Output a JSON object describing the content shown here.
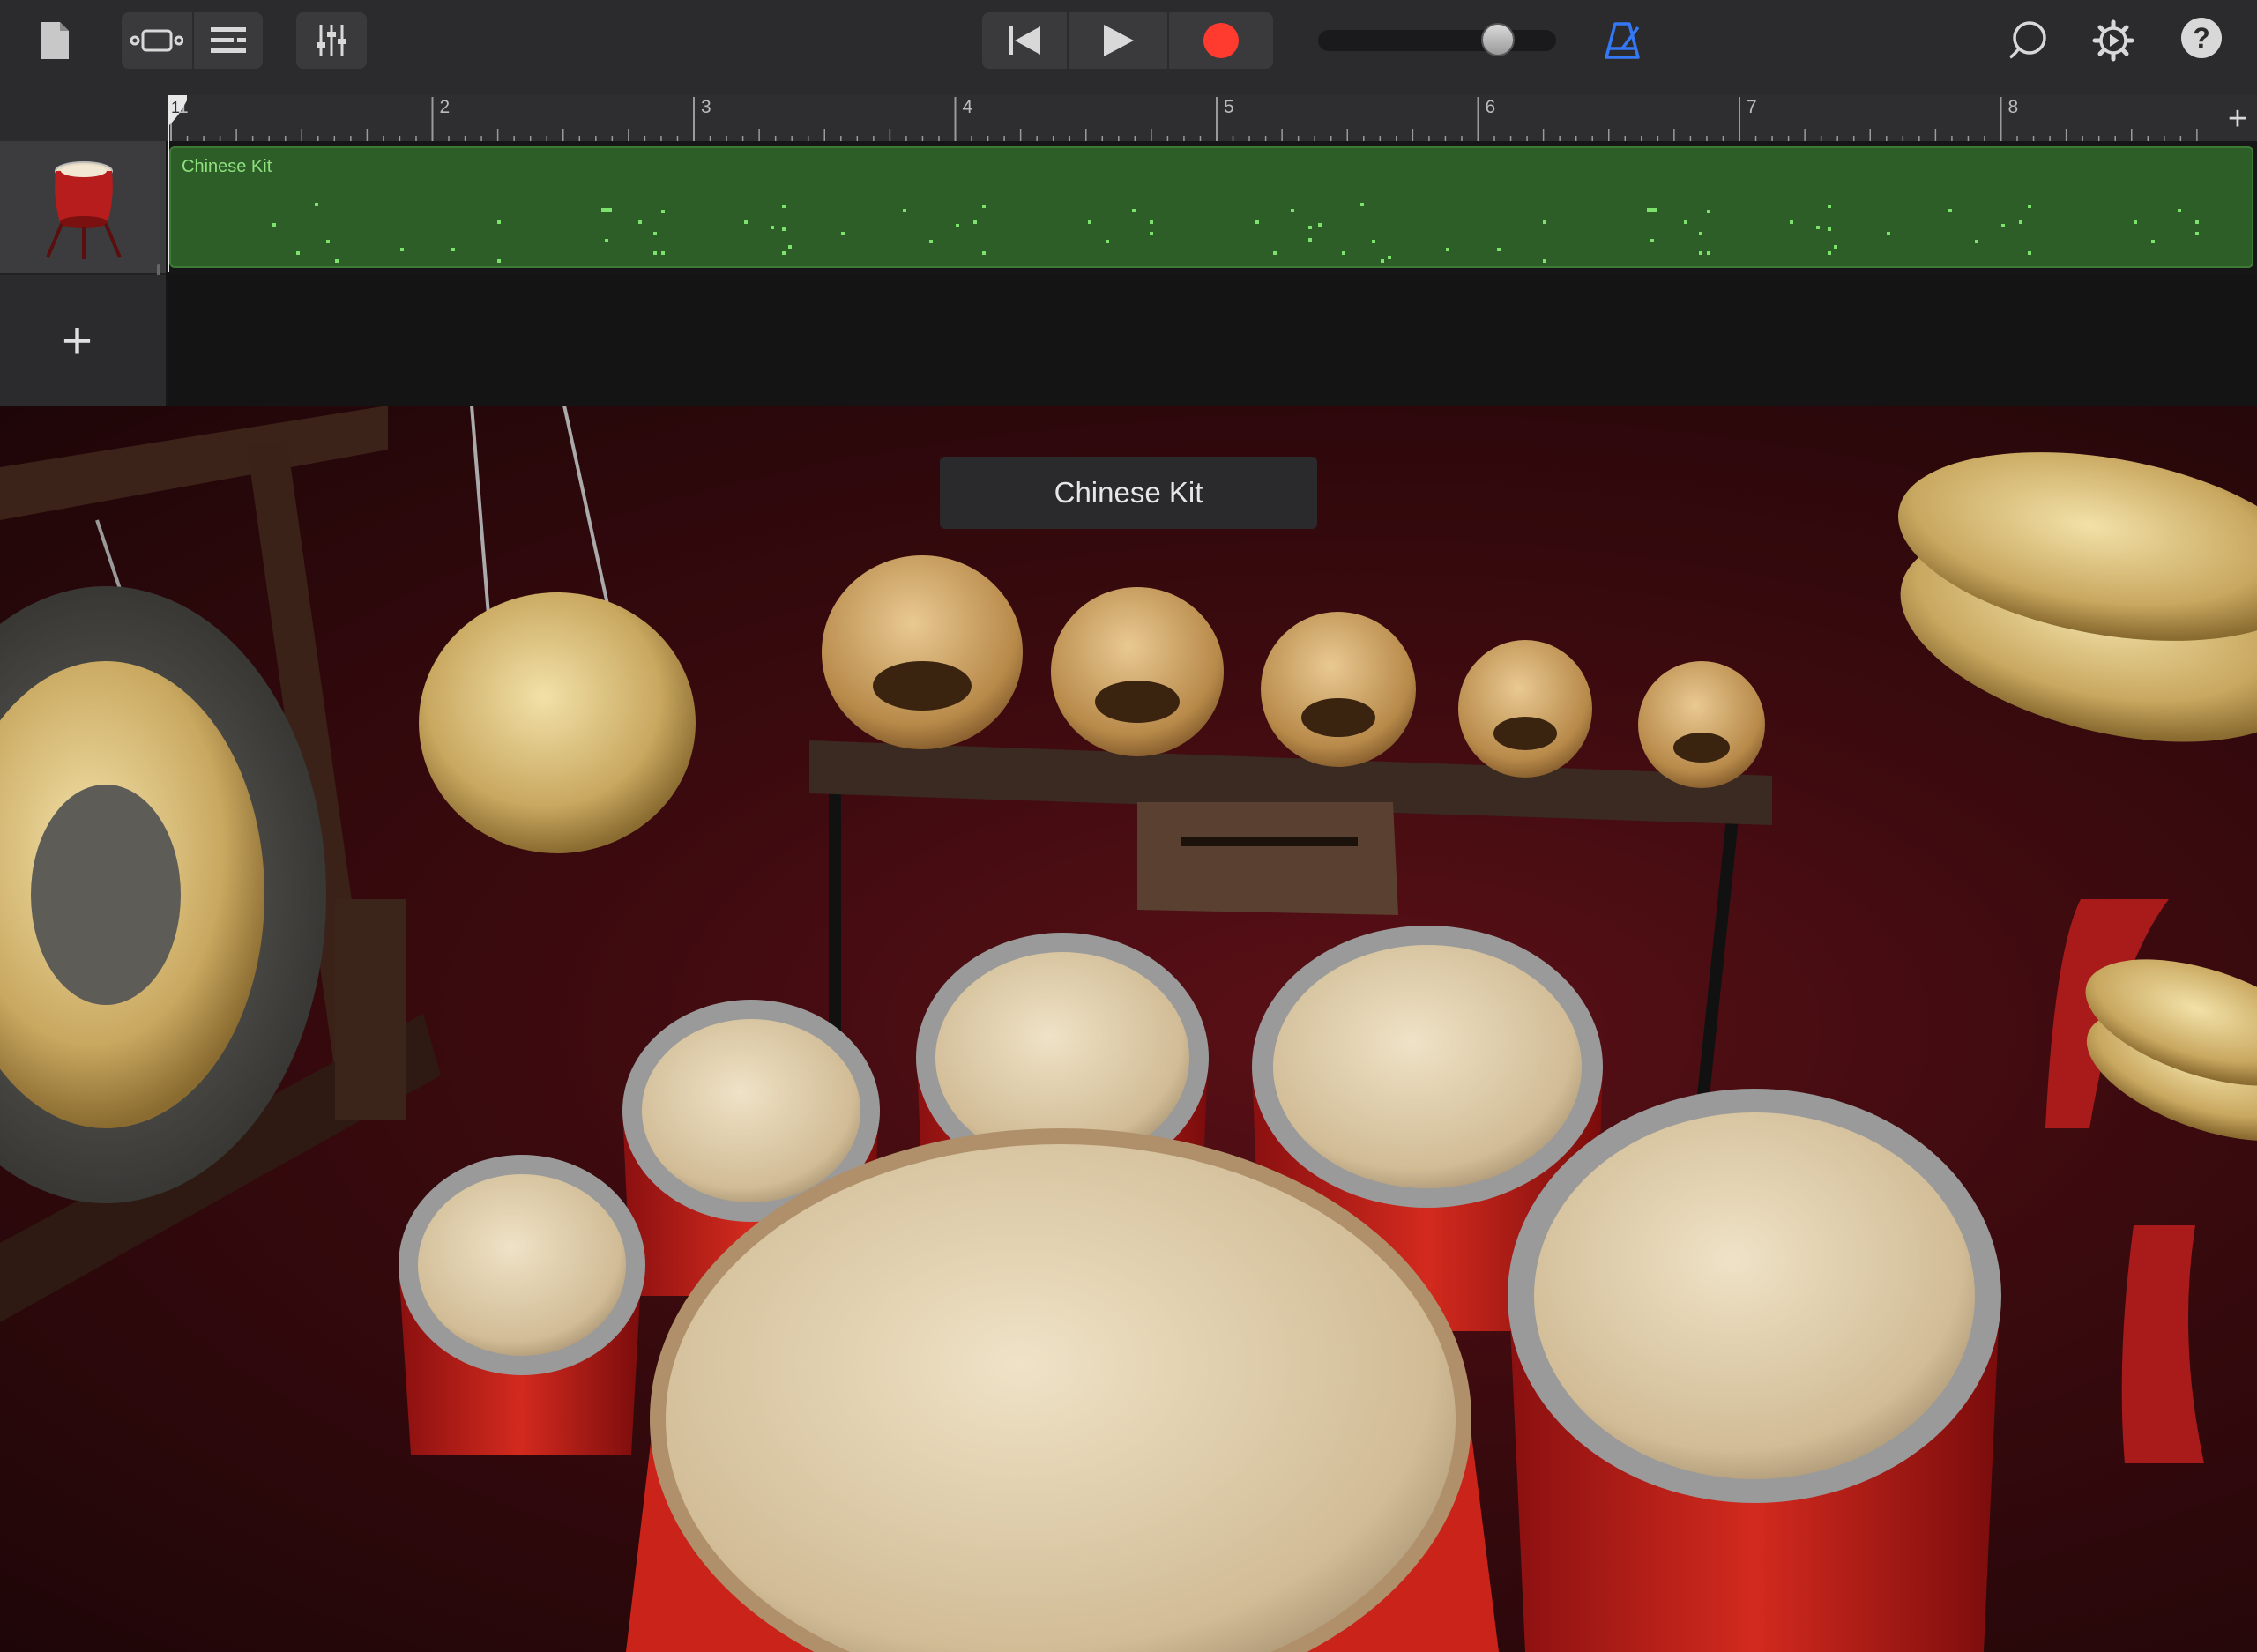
{
  "toolbar": {
    "icons": [
      "document-icon",
      "tracks-view-icon",
      "list-view-icon",
      "mixer-icon",
      "rewind-icon",
      "play-icon",
      "record-icon",
      "metronome-icon",
      "loop-icon",
      "settings-icon",
      "help-icon"
    ],
    "volume_level": 0.74,
    "help_label": "?"
  },
  "ruler": {
    "bars": [
      "1",
      "2",
      "3",
      "4",
      "5",
      "6",
      "7",
      "8"
    ],
    "add_label": "+"
  },
  "tracks": [
    {
      "region_name": "Chinese Kit",
      "color": "#2e5e28"
    }
  ],
  "add_track_label": "+",
  "instrument": {
    "name": "Chinese Kit",
    "pads": [
      "large-gong",
      "small-gong",
      "wood-block-1",
      "wood-block-2",
      "wood-block-3",
      "wood-block-4",
      "wood-block-5",
      "slit-drum",
      "tom-1",
      "tom-2",
      "tom-3",
      "tom-4",
      "big-drum",
      "tom-5",
      "cymbals",
      "small-cymbals"
    ]
  },
  "colors": {
    "accent": "#3478f6",
    "record": "#ff3b30",
    "region": "#2e5e28"
  }
}
